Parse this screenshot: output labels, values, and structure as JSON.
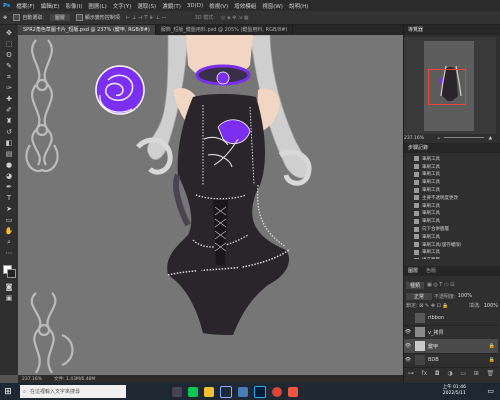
{
  "menu": [
    "檔案(F)",
    "編輯(E)",
    "影像(I)",
    "圖層(L)",
    "文字(Y)",
    "選取(S)",
    "濾鏡(T)",
    "3D(D)",
    "檢視(V)",
    "增效模組",
    "視窗(W)",
    "說明(H)"
  ],
  "options": {
    "auto_select_label": "自動選取:",
    "auto_select_value": "圖層",
    "transform_label": "顯示變形控制項",
    "mode_label": "3D 模式:"
  },
  "tabs": [
    {
      "label": "SPR2角色草圖卡片_短版.psd @ 237% (鍵甲, RGB/8#)",
      "active": true
    },
    {
      "label": "服飾_短版_鍵盤用料.psd @ 205% (鍵盤用料, RGB/8#)",
      "active": false
    }
  ],
  "statusbar": {
    "zoom": "237.16%",
    "doc": "文件: 1.43M/6.48M"
  },
  "panels": {
    "navigator_title": "導覽器",
    "zoom_value": "237.16%",
    "history_title": "步驟記錄",
    "layers_title": "圖層",
    "channels_title": "色版",
    "kind_label": "種類",
    "blend_mode": "正常",
    "opacity_label": "不透明度:",
    "opacity_value": "100%",
    "fill_label": "填滿:",
    "fill_value": "100%"
  },
  "history": [
    "筆刷工具",
    "筆刷工具",
    "筆刷工具",
    "筆刷工具",
    "筆刷工具",
    "主要不透明度更改",
    "筆刷工具",
    "筆刷工具",
    "筆刷工具",
    "向下合併圖層",
    "筆刷工具",
    "筆刷工具(儲存權限)",
    "筆刷工具",
    "填充圖層",
    "筆刷工具(儲存權限)",
    "名稱更改(儲存權限)",
    "筆刷工具",
    "筆刷工具"
  ],
  "layers": [
    {
      "name": "ribbon",
      "visible": false,
      "selected": false
    },
    {
      "name": "v_拷貝",
      "visible": true,
      "selected": false
    },
    {
      "name": "鍵甲",
      "visible": true,
      "selected": true
    },
    {
      "name": "BDB",
      "visible": true,
      "selected": false
    }
  ],
  "taskbar": {
    "search_placeholder": "在這裡輸入文字來搜尋",
    "time": "上午 01:46",
    "date": "2022/5/11"
  },
  "colors": {
    "purple": "#7b2ff0",
    "dress": "#2a252b",
    "canvas": "#737373"
  }
}
